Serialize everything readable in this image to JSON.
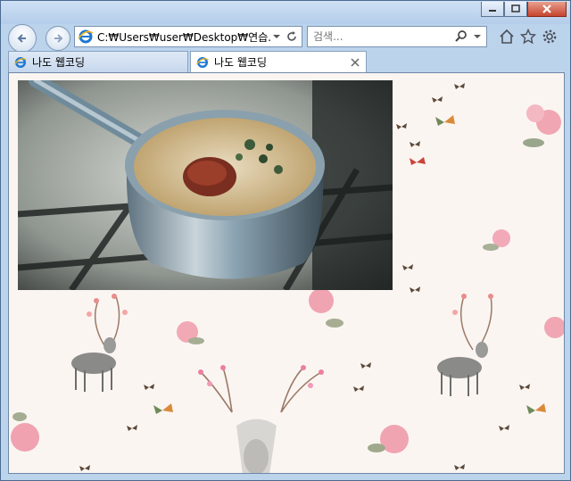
{
  "browser": {
    "address": "C:₩Users₩user₩Desktop₩연습.html",
    "search_placeholder": "검색..."
  },
  "tabs": [
    {
      "label": "나도 웹코딩",
      "active": false
    },
    {
      "label": "나도 웹코딩",
      "active": true
    }
  ],
  "colors": {
    "page_background": "#fbf5f2",
    "frame": "#bcd3ec",
    "close_button": "#c7452f"
  },
  "icons": [
    "back-icon",
    "forward-icon",
    "ie-logo-icon",
    "refresh-icon",
    "search-icon",
    "home-icon",
    "favorites-star-icon",
    "settings-gear-icon",
    "close-tab-icon"
  ]
}
